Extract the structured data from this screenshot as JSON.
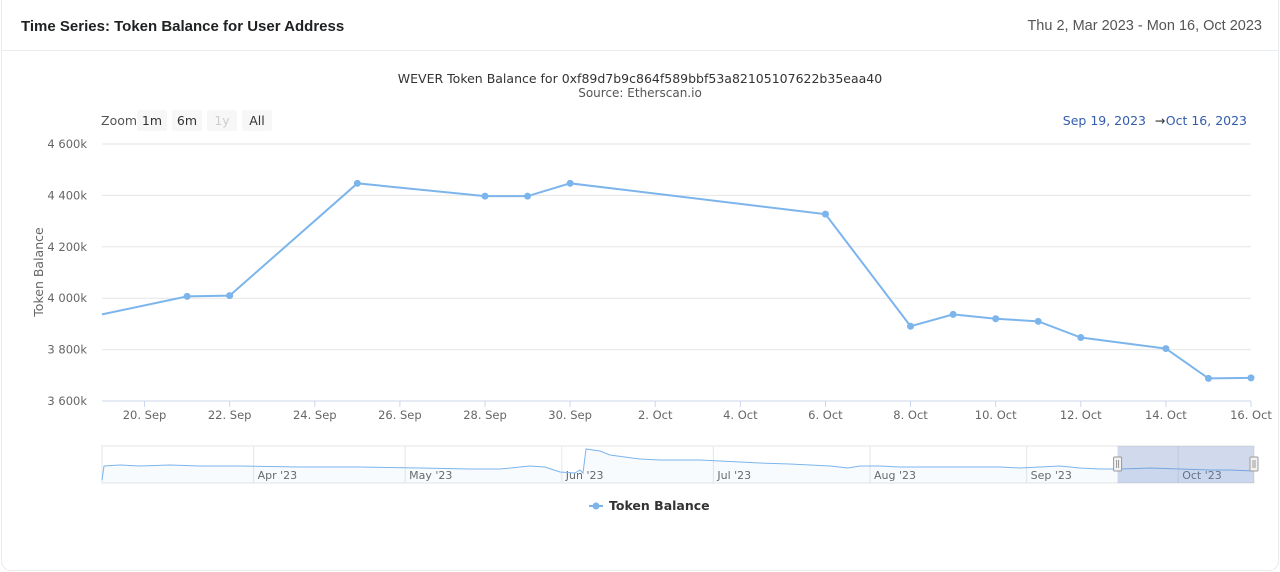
{
  "header": {
    "title": "Time Series: Token Balance for User Address",
    "date_range": "Thu 2, Mar 2023 - Mon 16, Oct 2023"
  },
  "range_selector": {
    "zoom_label": "Zoom",
    "buttons": [
      "1m",
      "6m",
      "1y",
      "All"
    ],
    "from": "Sep 19, 2023",
    "arrow": "→",
    "to": "Oct 16, 2023"
  },
  "colors": {
    "series": "#7cb5ec",
    "grid": "#e6e6e6",
    "navigator_mask": "rgba(102,133,194,0.3)"
  },
  "chart_data": {
    "type": "line",
    "title": "WEVER Token Balance for 0xf89d7b9c864f589bbf53a82105107622b35eaa40",
    "subtitle": "Source: Etherscan.io",
    "xlabel": "",
    "ylabel": "Token Balance",
    "ylim": [
      3600000,
      4600000
    ],
    "yticks": [
      3600000,
      3800000,
      4000000,
      4200000,
      4400000,
      4600000
    ],
    "ytick_labels": [
      "3 600k",
      "3 800k",
      "4 000k",
      "4 200k",
      "4 400k",
      "4 600k"
    ],
    "xlim": [
      "2023-09-19",
      "2023-10-16"
    ],
    "xticks": [
      "2023-09-20",
      "2023-09-22",
      "2023-09-24",
      "2023-09-26",
      "2023-09-28",
      "2023-09-30",
      "2023-10-02",
      "2023-10-04",
      "2023-10-06",
      "2023-10-08",
      "2023-10-10",
      "2023-10-12",
      "2023-10-14",
      "2023-10-16"
    ],
    "xtick_labels": [
      "20. Sep",
      "22. Sep",
      "24. Sep",
      "26. Sep",
      "28. Sep",
      "30. Sep",
      "2. Oct",
      "4. Oct",
      "6. Oct",
      "8. Oct",
      "10. Oct",
      "12. Oct",
      "14. Oct",
      "16. Oct"
    ],
    "grid": true,
    "legend": "bottom-center",
    "series": [
      {
        "name": "Token Balance",
        "x": [
          "2023-09-19",
          "2023-09-21",
          "2023-09-22",
          "2023-09-25",
          "2023-09-28",
          "2023-09-29",
          "2023-09-30",
          "2023-10-06",
          "2023-10-08",
          "2023-10-09",
          "2023-10-10",
          "2023-10-11",
          "2023-10-12",
          "2023-10-14",
          "2023-10-15",
          "2023-10-16"
        ],
        "y": [
          3937000,
          4007000,
          4010000,
          4447000,
          4397000,
          4397000,
          4447000,
          4327000,
          3891000,
          3937000,
          3920000,
          3910000,
          3847000,
          3804000,
          3688000,
          3690000
        ],
        "markers": [
          false,
          true,
          true,
          true,
          true,
          true,
          true,
          true,
          true,
          true,
          true,
          true,
          true,
          true,
          true,
          true
        ]
      }
    ],
    "navigator": {
      "xlim": [
        "2023-03-02",
        "2023-10-16"
      ],
      "labels": [
        "Apr '23",
        "May '23",
        "Jun '23",
        "Jul '23",
        "Aug '23",
        "Sep '23",
        "Oct '23"
      ],
      "label_dates": [
        "2023-04-01",
        "2023-05-01",
        "2023-06-01",
        "2023-07-01",
        "2023-08-01",
        "2023-09-01",
        "2023-10-01"
      ],
      "selected": [
        "2023-09-19",
        "2023-10-16"
      ]
    }
  }
}
